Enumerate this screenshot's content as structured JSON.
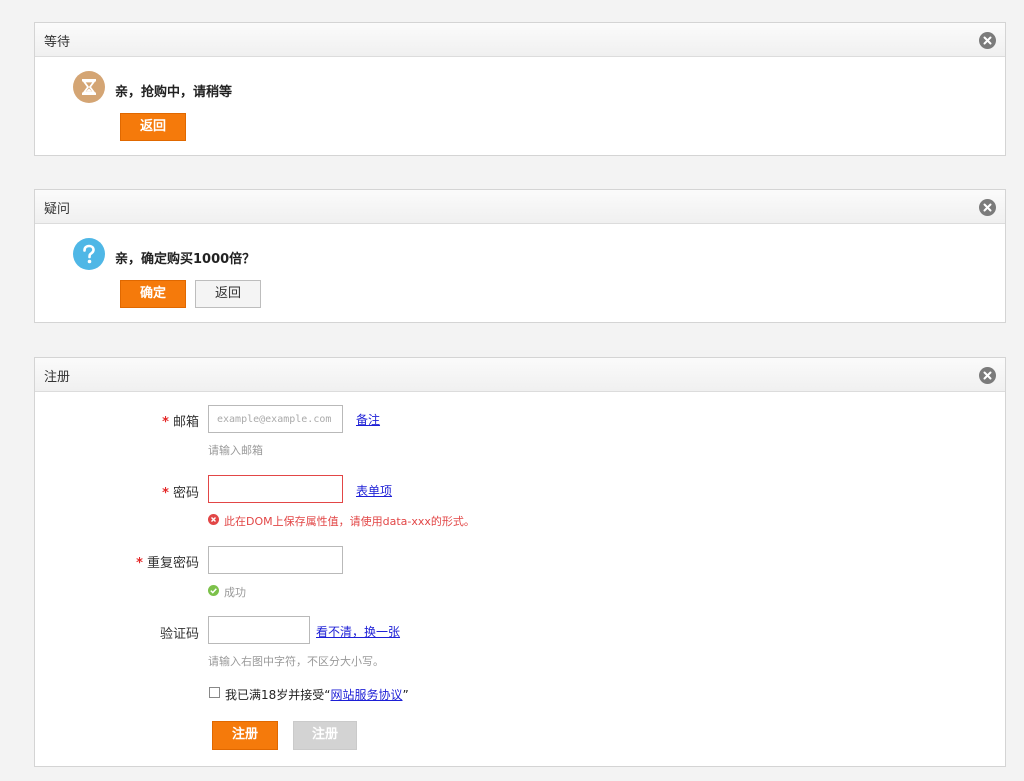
{
  "dialogs": {
    "wait": {
      "title": "等待",
      "message": "亲，抢购中，请稍等",
      "back_label": "返回"
    },
    "question": {
      "title": "疑问",
      "message": "亲，确定购买1000倍？",
      "confirm_label": "确定",
      "back_label": "返回"
    },
    "register": {
      "title": "注册",
      "email": {
        "label": "邮箱",
        "placeholder": "example@example.com",
        "value": "",
        "link": "备注",
        "hint": "请输入邮箱"
      },
      "password": {
        "label": "密码",
        "value": "",
        "link": "表单项",
        "error": "此在DOM上保存属性值，请使用data-xxx的形式。"
      },
      "repeat_password": {
        "label": "重复密码",
        "value": "",
        "success": "成功"
      },
      "captcha": {
        "label": "验证码",
        "value": "",
        "link": "看不清，换一张",
        "hint": "请输入右图中字符，不区分大小写。"
      },
      "agreement": {
        "prefix": "我已满18岁并接受“",
        "link": "网站服务协议",
        "suffix": "”",
        "checked": false
      },
      "required_mark": "*",
      "register_label": "注册",
      "register_disabled_label": "注册"
    }
  },
  "icons": {
    "close": "close-icon",
    "hourglass": "hourglass-icon",
    "question": "question-icon",
    "error": "error-icon",
    "success": "success-icon"
  },
  "colors": {
    "accent": "#f57a0b",
    "error": "#e24646",
    "success": "#7cc14a",
    "link": "#1d1fd6",
    "wait_icon": "#d4a574",
    "question_icon": "#4fb7e6"
  }
}
